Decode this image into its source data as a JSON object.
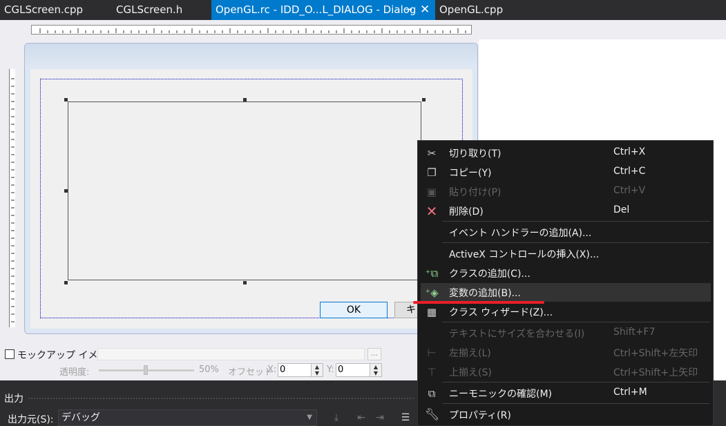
{
  "tabs": [
    {
      "label": "CGLScreen.cpp"
    },
    {
      "label": "CGLScreen.h"
    },
    {
      "label": "OpenGL.rc - IDD_O...L_DIALOG - Dialog",
      "active": true
    },
    {
      "label": "OpenGL.cpp"
    }
  ],
  "tab_icons": {
    "pin": "pin-icon",
    "close": "close-icon"
  },
  "dialog": {
    "ok_label": "OK",
    "cancel_label": "キ"
  },
  "mockup": {
    "checkbox_label": "モックアップ イメージ",
    "browse_label": "...",
    "opacity_label": "透明度:",
    "opacity_value": "50%",
    "offset_label": "オフセット",
    "x_label": "X:",
    "x_value": "0",
    "y_label": "Y:",
    "y_value": "0"
  },
  "output": {
    "title": "出力",
    "source_label": "出力元(S):",
    "source_value": "デバッグ"
  },
  "context_menu": {
    "items": [
      {
        "label": "切り取り(T)",
        "shortcut": "Ctrl+X",
        "icon": "scissors-icon",
        "enabled": true
      },
      {
        "label": "コピー(Y)",
        "shortcut": "Ctrl+C",
        "icon": "copy-icon",
        "enabled": true
      },
      {
        "label": "貼り付け(P)",
        "shortcut": "Ctrl+V",
        "icon": "paste-icon",
        "enabled": false
      },
      {
        "label": "削除(D)",
        "shortcut": "Del",
        "icon": "delete-icon",
        "enabled": true
      },
      {
        "label": "イベント ハンドラーの追加(A)...",
        "shortcut": "",
        "icon": "",
        "enabled": true
      },
      {
        "label": "ActiveX コントロールの挿入(X)...",
        "shortcut": "",
        "icon": "",
        "enabled": true
      },
      {
        "label": "クラスの追加(C)...",
        "shortcut": "",
        "icon": "add-class-icon",
        "enabled": true
      },
      {
        "label": "変数の追加(B)...",
        "shortcut": "",
        "icon": "add-variable-icon",
        "enabled": true,
        "highlighted": true
      },
      {
        "label": "クラス ウィザード(Z)...",
        "shortcut": "",
        "icon": "class-wizard-icon",
        "enabled": true
      },
      {
        "label": "テキストにサイズを合わせる(I)",
        "shortcut": "Shift+F7",
        "icon": "",
        "enabled": false
      },
      {
        "label": "左揃え(L)",
        "shortcut": "Ctrl+Shift+左矢印",
        "icon": "align-left-icon",
        "enabled": false
      },
      {
        "label": "上揃え(S)",
        "shortcut": "Ctrl+Shift+上矢印",
        "icon": "align-top-icon",
        "enabled": false
      },
      {
        "label": "ニーモニックの確認(M)",
        "shortcut": "Ctrl+M",
        "icon": "check-mnemonics-icon",
        "enabled": true
      },
      {
        "label": "プロパティ(R)",
        "shortcut": "",
        "icon": "wrench-icon",
        "enabled": true
      }
    ]
  },
  "colors": {
    "accent": "#007acc",
    "menu_bg": "#1b1b1c",
    "annotation_red": "#e8202a",
    "delete_icon": "#f1707b"
  }
}
